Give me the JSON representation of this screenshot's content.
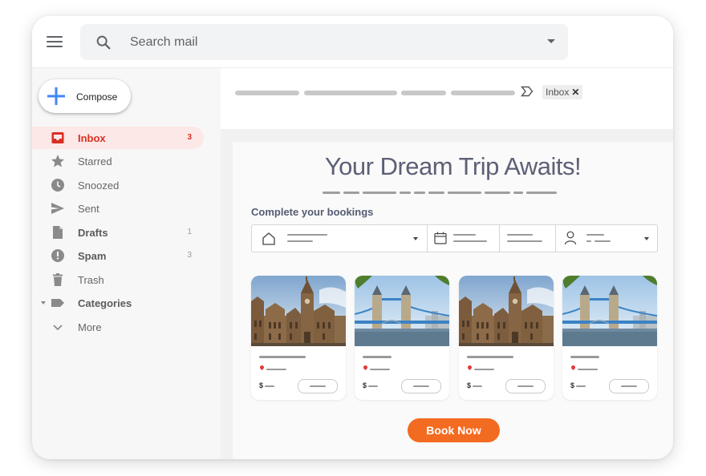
{
  "search": {
    "placeholder": "Search mail"
  },
  "compose": {
    "label": "Compose"
  },
  "nav": [
    {
      "label": "Inbox",
      "count": "3",
      "icon": "inbox-icon"
    },
    {
      "label": "Starred",
      "count": "",
      "icon": "star-icon"
    },
    {
      "label": "Snoozed",
      "count": "",
      "icon": "clock-icon"
    },
    {
      "label": "Sent",
      "count": "",
      "icon": "send-icon"
    },
    {
      "label": "Drafts",
      "count": "1",
      "icon": "draft-icon"
    },
    {
      "label": "Spam",
      "count": "3",
      "icon": "spam-icon"
    },
    {
      "label": "Trash",
      "count": "",
      "icon": "trash-icon"
    },
    {
      "label": "Categories",
      "count": "",
      "icon": "label-icon"
    },
    {
      "label": "More",
      "count": "",
      "icon": "chevron-down-icon"
    }
  ],
  "label_chip": {
    "text": "Inbox",
    "close": "✕"
  },
  "email": {
    "title": "Your Dream Trip Awaits!",
    "subtitle": "Complete your bookings",
    "cards": [
      {
        "image": "gothic-building",
        "price_symbol": "$"
      },
      {
        "image": "tower-bridge",
        "price_symbol": "$"
      },
      {
        "image": "gothic-building",
        "price_symbol": "$"
      },
      {
        "image": "tower-bridge",
        "price_symbol": "$"
      }
    ],
    "cta": "Book Now"
  },
  "colors": {
    "accent": "#f36b21",
    "inbox_active": "#d93025",
    "title": "#5d6076"
  }
}
